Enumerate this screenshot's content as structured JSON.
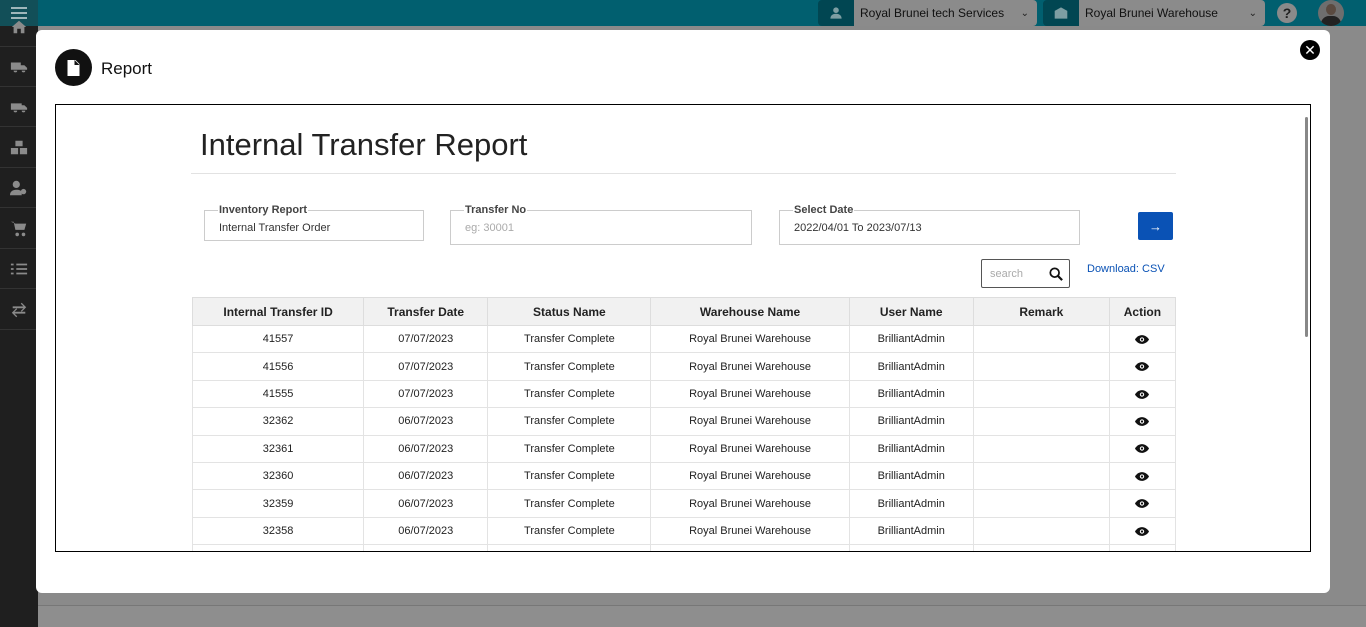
{
  "header": {
    "company_select": "Royal Brunei tech Services",
    "warehouse_select": "Royal Brunei Warehouse",
    "help_label": "?"
  },
  "sidebar": {
    "items": [
      "home-icon",
      "truck-icon",
      "van-icon",
      "boxes-icon",
      "user-gear-icon",
      "cart-icon",
      "list-check-icon",
      "transfer-icon"
    ]
  },
  "modal": {
    "title": "Report",
    "close_label": "✕"
  },
  "report": {
    "title": "Internal Transfer Report",
    "filters": {
      "inventory_report_label": "Inventory Report",
      "inventory_report_value": "Internal Transfer Order",
      "transfer_no_label": "Transfer No",
      "transfer_no_placeholder": "eg: 30001",
      "select_date_label": "Select Date",
      "select_date_value": "2022/04/01 To 2023/07/13"
    },
    "go_label": "→",
    "search_placeholder": "search",
    "download_label": "Download: CSV"
  },
  "table": {
    "columns": [
      "Internal Transfer ID",
      "Transfer Date",
      "Status Name",
      "Warehouse Name",
      "User Name",
      "Remark",
      "Action"
    ],
    "rows": [
      [
        "41557",
        "07/07/2023",
        "Transfer Complete",
        "Royal Brunei Warehouse",
        "BrilliantAdmin",
        ""
      ],
      [
        "41556",
        "07/07/2023",
        "Transfer Complete",
        "Royal Brunei Warehouse",
        "BrilliantAdmin",
        ""
      ],
      [
        "41555",
        "07/07/2023",
        "Transfer Complete",
        "Royal Brunei Warehouse",
        "BrilliantAdmin",
        ""
      ],
      [
        "32362",
        "06/07/2023",
        "Transfer Complete",
        "Royal Brunei Warehouse",
        "BrilliantAdmin",
        ""
      ],
      [
        "32361",
        "06/07/2023",
        "Transfer Complete",
        "Royal Brunei Warehouse",
        "BrilliantAdmin",
        ""
      ],
      [
        "32360",
        "06/07/2023",
        "Transfer Complete",
        "Royal Brunei Warehouse",
        "BrilliantAdmin",
        ""
      ],
      [
        "32359",
        "06/07/2023",
        "Transfer Complete",
        "Royal Brunei Warehouse",
        "BrilliantAdmin",
        ""
      ],
      [
        "32358",
        "06/07/2023",
        "Transfer Complete",
        "Royal Brunei Warehouse",
        "BrilliantAdmin",
        ""
      ],
      [
        "",
        "",
        "",
        "",
        "",
        ""
      ]
    ]
  },
  "colors": {
    "topbar": "#015f6f",
    "sidebar": "#1f1f1f",
    "accent": "#0a52b5"
  }
}
